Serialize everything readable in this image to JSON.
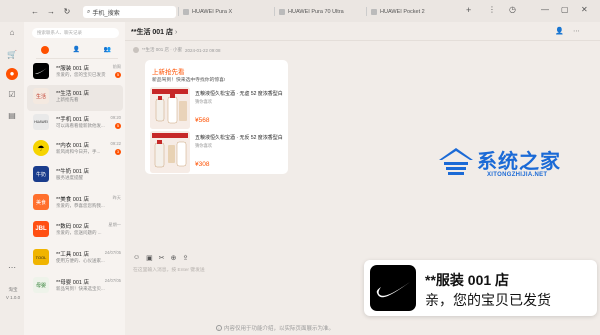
{
  "browser": {
    "nav_icons": [
      "back-icon",
      "forward-icon",
      "refresh-icon"
    ],
    "search_text": "手机_搜索",
    "tabs": [
      {
        "label": "HUAWEI Pura X"
      },
      {
        "label": "HUAWEI Pura 70 Ultra"
      },
      {
        "label": "HUAWEI Pocket 2"
      }
    ]
  },
  "sidebar": {
    "app_name": "淘宝",
    "version": "V 1.0.0"
  },
  "chat_list": {
    "search_placeholder": "搜索联系人、聊天记录",
    "items": [
      {
        "name": "**服装 001 店",
        "msg": "亲爱的，您的宝贝已发货",
        "date": "前周",
        "badge": "5",
        "avatar_text": "NIKE",
        "avatar_color": "#000000"
      },
      {
        "name": "**生活 001 店",
        "msg": "上新抢先看",
        "date": "",
        "badge": "",
        "avatar_text": "生活",
        "avatar_color": "#f4e9e0"
      },
      {
        "name": "**手机 001 店",
        "msg": "可以再看看能新款他发...",
        "date": "09:20",
        "badge": "5",
        "avatar_text": "HUAWEI",
        "avatar_color": "#e9e9e9"
      },
      {
        "name": "**内衣 001 店",
        "msg": "新风尚和今日开，手...",
        "date": "09:22",
        "badge": "3",
        "avatar_text": "☂",
        "avatar_color": "#f6d400"
      },
      {
        "name": "**牛奶 001 店",
        "msg": "服务进度提醒",
        "date": "",
        "badge": "",
        "avatar_text": "牛奶",
        "avatar_color": "#1a3c8c"
      },
      {
        "name": "**美食 001 店",
        "msg": "亲爱的，恭喜您您购我...",
        "date": "昨天",
        "badge": "",
        "avatar_text": "美食",
        "avatar_color": "#ff6f2c"
      },
      {
        "name": "**数码 002 店",
        "msg": "亲爱的，您送问题的 ...",
        "date": "星期一",
        "badge": "",
        "avatar_text": "JBL",
        "avatar_color": "#ff4f12"
      },
      {
        "name": "**工具 001 店",
        "msg": "使用方便的、心仪送家...",
        "date": "24/07/05",
        "badge": "",
        "avatar_text": "TOOL",
        "avatar_color": "#f0b400"
      },
      {
        "name": "**母婴 001 店",
        "msg": "新品驾到！快来选宝贝...",
        "date": "24/07/05",
        "badge": "",
        "avatar_text": "母婴",
        "avatar_color": "#eef3ea"
      }
    ]
  },
  "chat": {
    "title": "**生活 001 店",
    "meta_sender": "**生活 001 店 · 小蜜",
    "meta_time": "2024-01-22 09:08",
    "card": {
      "title": "上新抢先看",
      "subtitle": "新品驾到！快来选中寺找你的惊喜!",
      "products": [
        {
          "name": "五粮液恒久松宝酒 · 无虚 52 度浓香型白酒",
          "reason": "猜你喜欢",
          "price": "¥568"
        },
        {
          "name": "五粮液恒久松宝酒 · 无反 52 度浓香型白酒",
          "reason": "猜你喜欢",
          "price": "¥308"
        }
      ]
    },
    "input_placeholder": "在这里输入消息，按 Enter 键发送"
  },
  "notice": "内容仅用于功能介绍，以实际页面展示为准。",
  "watermark": {
    "title": "系统之家",
    "subtitle": "XITONGZHIJIA.NET"
  },
  "toast": {
    "name": "**服装 001 店",
    "message": "亲，您的宝贝已发货"
  }
}
